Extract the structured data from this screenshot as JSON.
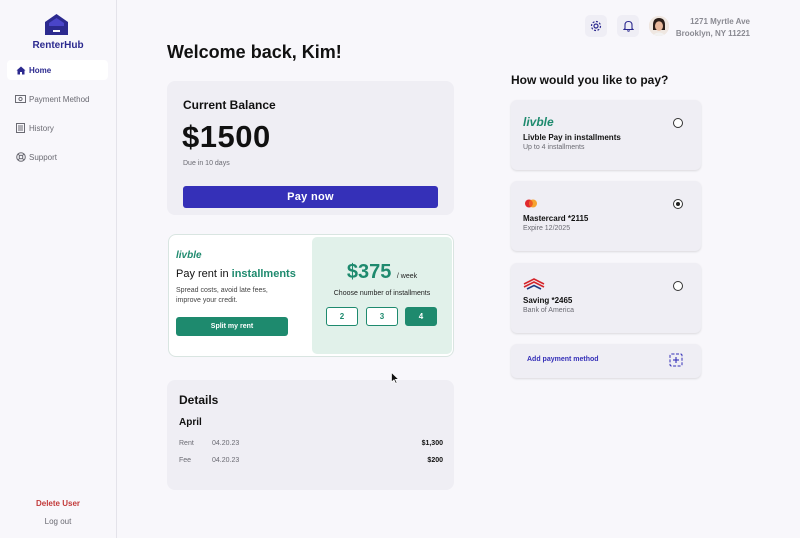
{
  "app": {
    "name": "RenterHub",
    "logo_icon": "house-logo-icon"
  },
  "sidebar": {
    "items": [
      {
        "label": "Home",
        "icon": "home-icon",
        "active": true
      },
      {
        "label": "Payment Method",
        "icon": "cash-icon",
        "active": false
      },
      {
        "label": "History",
        "icon": "history-icon",
        "active": false
      },
      {
        "label": "Support",
        "icon": "support-icon",
        "active": false
      }
    ],
    "delete_user": "Delete User",
    "logout": "Log out"
  },
  "header": {
    "address_line1": "1271 Myrtle Ave",
    "address_line2": "Brooklyn, NY 11221",
    "icons": [
      "gear-icon",
      "bell-icon",
      "avatar"
    ]
  },
  "welcome": "Welcome back, Kim!",
  "balance": {
    "title": "Current Balance",
    "amount": "$1500",
    "due": "Due in 10 days",
    "pay_now": "Pay now"
  },
  "promo": {
    "logo": "livble",
    "headline_prefix": "Pay rent in ",
    "headline_highlight": "installments",
    "subtext": "Spread costs, avoid late fees, improve your credit.",
    "button": "Split my rent",
    "weekly_amount": "$375",
    "weekly_unit": "/ week",
    "choose_label": "Choose number of installments",
    "installments": [
      "2",
      "3",
      "4"
    ],
    "selected_installment": "4"
  },
  "details": {
    "title": "Details",
    "month": "April",
    "rows": [
      {
        "label": "Rent",
        "date": "04.20.23",
        "amount": "$1,300"
      },
      {
        "label": "Fee",
        "date": "04.20.23",
        "amount": "$200"
      }
    ]
  },
  "payment": {
    "question": "How would you like to pay?",
    "methods": [
      {
        "logo": "livble",
        "name": "Livble Pay in installments",
        "sub": "Up to 4 installments",
        "selected": false
      },
      {
        "logo": "mastercard-icon",
        "name": "Mastercard *2115",
        "sub": "Expire 12/2025",
        "selected": true
      },
      {
        "logo": "bank-of-america-icon",
        "name": "Saving *2465",
        "sub": "Bank of America",
        "selected": false
      }
    ],
    "add_method": "Add payment method"
  },
  "colors": {
    "primary": "#3530b8",
    "brand": "#2c2a8f",
    "livble_green": "#1e8a6e",
    "danger": "#c23a3a"
  }
}
